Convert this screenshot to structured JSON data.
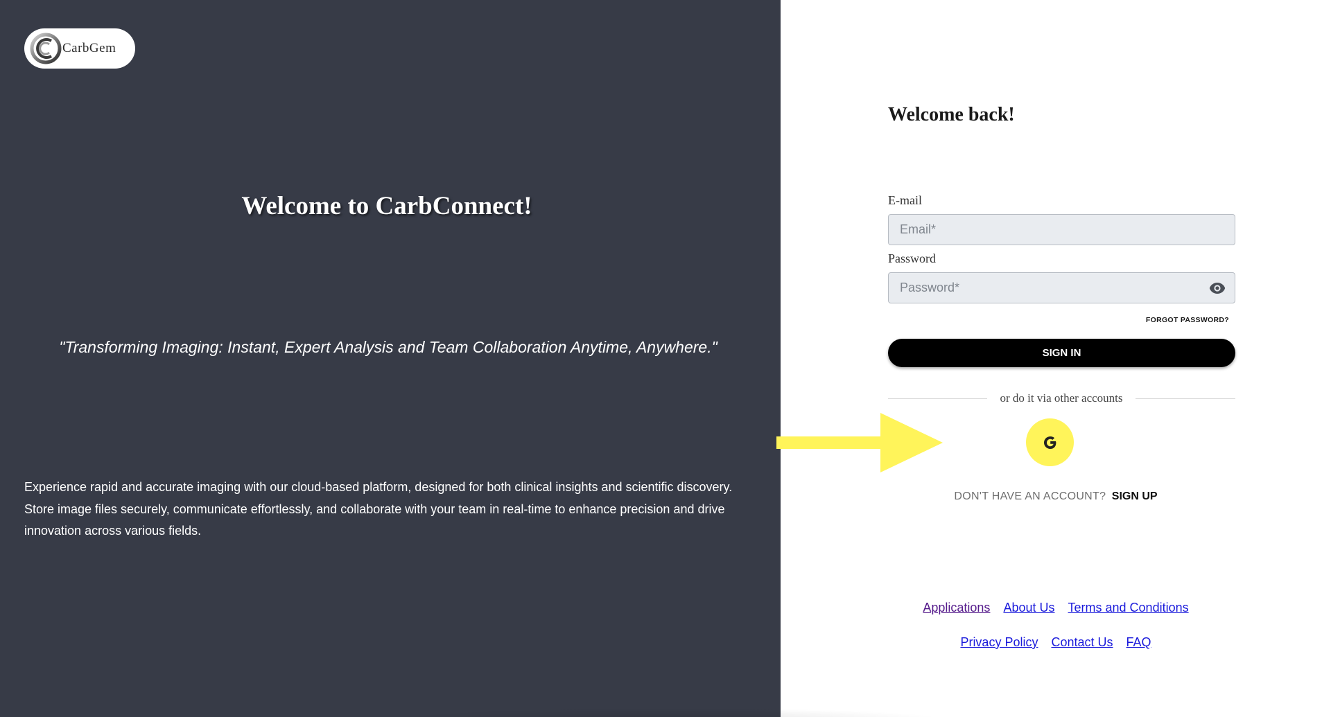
{
  "left": {
    "logo_text": "CarbGem",
    "title": "Welcome to CarbConnect!",
    "tagline": "\"Transforming Imaging: Instant, Expert Analysis and Team Collaboration Anytime, Anywhere.\"",
    "description": "Experience rapid and accurate imaging with our cloud-based platform, designed for both clinical insights and scientific discovery. Store image files securely, communicate effortlessly, and collaborate with your team in real-time to enhance precision and drive innovation across various fields."
  },
  "login": {
    "heading": "Welcome back!",
    "email_label": "E-mail",
    "email_placeholder": "Email*",
    "email_value": "",
    "password_label": "Password",
    "password_placeholder": "Password*",
    "password_value": "",
    "forgot_password": "FORGOT PASSWORD?",
    "sign_in": "SIGN IN",
    "divider_text": "or do it via other accounts",
    "google_icon": "google-icon",
    "no_account": "DON'T HAVE AN ACCOUNT?",
    "sign_up": "SIGN UP"
  },
  "footer": {
    "row1": [
      "Applications",
      "About Us",
      "Terms and Conditions"
    ],
    "row2": [
      "Privacy Policy",
      "Contact Us",
      "FAQ"
    ]
  },
  "colors": {
    "left_panel_bg": "#373b47",
    "highlight_yellow": "#fff45a",
    "link_blue": "#1a1adb",
    "link_visited": "#551a8b"
  }
}
